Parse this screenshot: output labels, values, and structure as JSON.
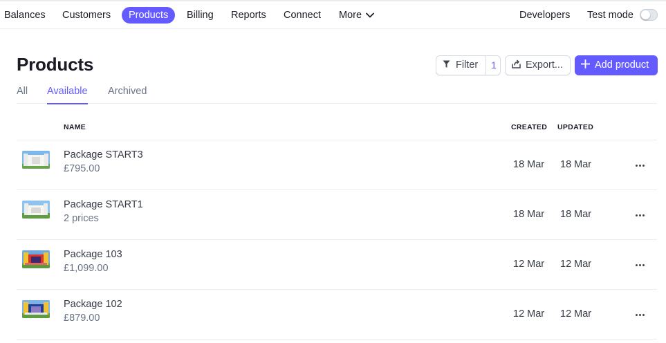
{
  "nav": {
    "items": [
      {
        "label": "Balances"
      },
      {
        "label": "Customers"
      },
      {
        "label": "Products",
        "active": true
      },
      {
        "label": "Billing"
      },
      {
        "label": "Reports"
      },
      {
        "label": "Connect"
      },
      {
        "label": "More"
      }
    ],
    "developers": "Developers",
    "test_mode": "Test mode",
    "test_mode_on": false
  },
  "header": {
    "title": "Products",
    "filter_label": "Filter",
    "filter_count": "1",
    "export_label": "Export...",
    "add_label": "Add product"
  },
  "tabs": [
    {
      "label": "All"
    },
    {
      "label": "Available",
      "active": true
    },
    {
      "label": "Archived"
    }
  ],
  "table": {
    "columns": {
      "name": "NAME",
      "created": "CREATED",
      "updated": "UPDATED"
    },
    "rows": [
      {
        "name": "Package START3",
        "sub": "£795.00",
        "created": "18 Mar",
        "updated": "18 Mar",
        "thumb": "white-castle"
      },
      {
        "name": "Package START1",
        "sub": "2 prices",
        "created": "18 Mar",
        "updated": "18 Mar",
        "thumb": "white-castle"
      },
      {
        "name": "Package 103",
        "sub": "£1,099.00",
        "created": "12 Mar",
        "updated": "12 Mar",
        "thumb": "red-castle"
      },
      {
        "name": "Package 102",
        "sub": "£879.00",
        "created": "12 Mar",
        "updated": "12 Mar",
        "thumb": "blue-castle"
      }
    ]
  },
  "colors": {
    "accent": "#635bff",
    "text": "#1a1b25",
    "muted": "#687385",
    "border": "#ebeef1"
  }
}
